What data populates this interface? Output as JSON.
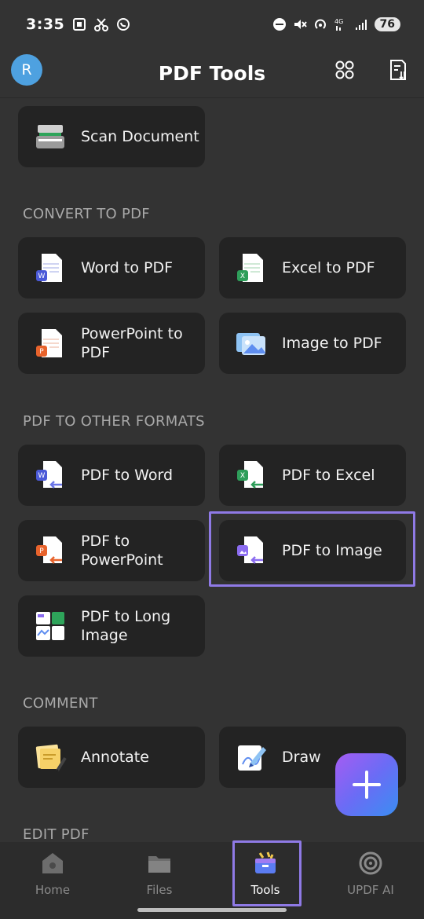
{
  "status_bar": {
    "time": "3:35",
    "battery": "76",
    "network": "4G"
  },
  "header": {
    "avatar_letter": "R",
    "title": "PDF Tools"
  },
  "scan": {
    "label": "Scan Document"
  },
  "sections": {
    "convert": {
      "title": "CONVERT TO PDF",
      "items": [
        {
          "label": "Word to PDF"
        },
        {
          "label": "Excel to PDF"
        },
        {
          "label": "PowerPoint to PDF"
        },
        {
          "label": "Image to PDF"
        }
      ]
    },
    "other": {
      "title": "PDF TO OTHER FORMATS",
      "items": [
        {
          "label": "PDF to Word"
        },
        {
          "label": "PDF to Excel"
        },
        {
          "label": "PDF to PowerPoint"
        },
        {
          "label": "PDF to Image"
        },
        {
          "label": "PDF to Long Image"
        }
      ]
    },
    "comment": {
      "title": "COMMENT",
      "items": [
        {
          "label": "Annotate"
        },
        {
          "label": "Draw"
        }
      ]
    },
    "edit": {
      "title": "EDIT PDF"
    }
  },
  "bottom_nav": {
    "items": [
      {
        "label": "Home"
      },
      {
        "label": "Files"
      },
      {
        "label": "Tools"
      },
      {
        "label": "UPDF AI"
      }
    ],
    "active": "Tools"
  },
  "colors": {
    "background": "#333333",
    "tile": "#232323",
    "highlight": "#8f7ae6",
    "word": "#4b5ad8",
    "excel": "#2e9e5a",
    "powerpoint": "#e8632c",
    "accent_purple": "#8b6cf0"
  }
}
